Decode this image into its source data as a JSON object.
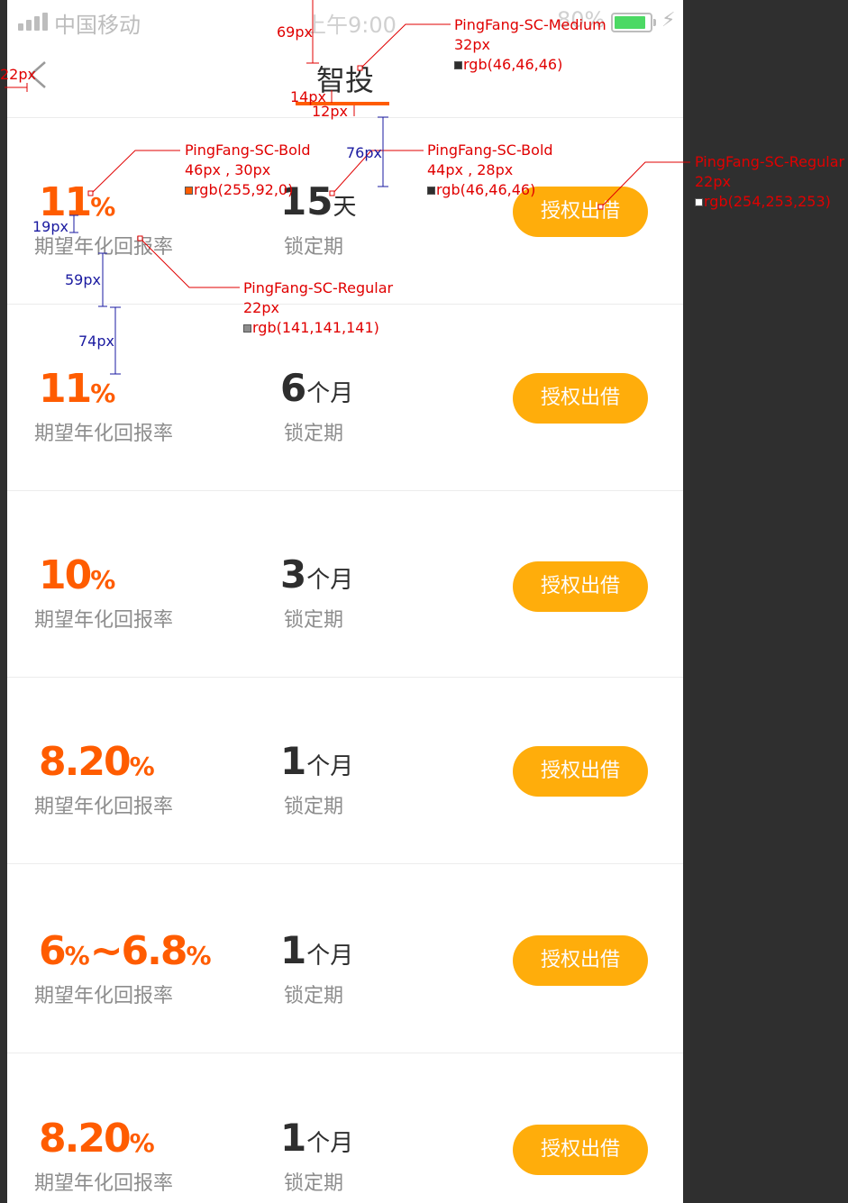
{
  "status_bar": {
    "carrier": "中国移动",
    "time": "上午9:00",
    "battery_percent": "80%"
  },
  "nav": {
    "title": "智投"
  },
  "labels": {
    "rate": "期望年化回报率",
    "term": "锁定期",
    "button": "授权出借"
  },
  "products": [
    {
      "rate_parts": [
        {
          "n": "11",
          "p": "%"
        }
      ],
      "term_num": "15",
      "term_unit": "天"
    },
    {
      "rate_parts": [
        {
          "n": "11",
          "p": "%"
        }
      ],
      "term_num": "6",
      "term_unit": "个月"
    },
    {
      "rate_parts": [
        {
          "n": "10",
          "p": "%"
        }
      ],
      "term_num": "3",
      "term_unit": "个月"
    },
    {
      "rate_parts": [
        {
          "n": "8.20",
          "p": "%"
        }
      ],
      "term_num": "1",
      "term_unit": "个月"
    },
    {
      "rate_parts": [
        {
          "n": "6",
          "p": "%"
        },
        {
          "n": "~6.8",
          "p": "%"
        }
      ],
      "term_num": "1",
      "term_unit": "个月"
    },
    {
      "rate_parts": [
        {
          "n": "8.20",
          "p": "%"
        }
      ],
      "term_num": "1",
      "term_unit": "个月"
    }
  ],
  "annotations": {
    "title_font": "PingFang-SC-Medium",
    "title_size": "32px",
    "title_color": "rgb(46,46,46)",
    "rate_font": "PingFang-SC-Bold",
    "rate_size": "46px , 30px",
    "rate_color": "rgb(255,92,0)",
    "term_font": "PingFang-SC-Bold",
    "term_size": "44px , 28px",
    "term_color": "rgb(46,46,46)",
    "btn_font": "PingFang-SC-Regular",
    "btn_size": "22px",
    "btn_color": "rgb(254,253,253)",
    "label_font": "PingFang-SC-Regular",
    "label_size": "22px",
    "label_color": "rgb(141,141,141)",
    "m_69": "69px",
    "m_22": "22px",
    "m_14": "14px",
    "m_12": "12px",
    "m_76": "76px",
    "m_19": "19px",
    "m_59": "59px",
    "m_74": "74px"
  },
  "colors": {
    "accent": "#ff5c00",
    "button": "#ffad0b",
    "text_dark": "#2e2e2e",
    "text_grey": "#8d8d8d"
  }
}
